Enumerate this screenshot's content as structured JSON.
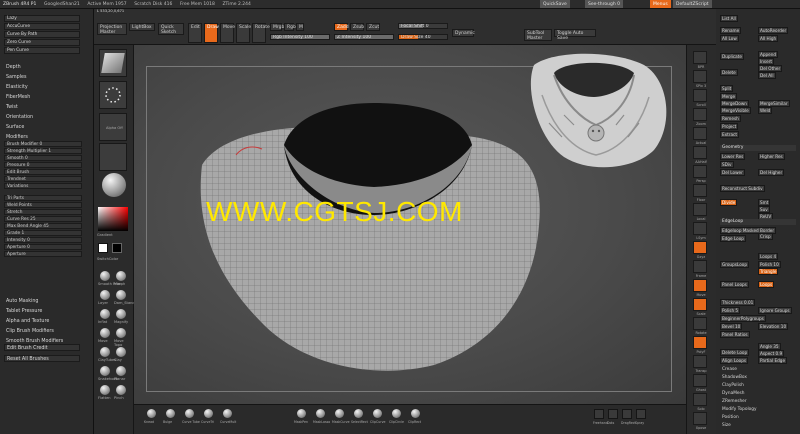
{
  "menubar": {
    "items": [
      "ZBrush 4R4 P1",
      "GoogledShan21",
      "Active Mem 1957",
      "Scratch Disk 416",
      "Free Mem 1018",
      "ZTime 2.244"
    ],
    "right": [
      "QuickSave",
      "See-through 0",
      "Menus",
      "DefaultZScript"
    ],
    "menus": [
      "Alpha",
      "Brush",
      "Color",
      "Document",
      "Draw",
      "Edit",
      "File",
      "Layer",
      "Light",
      "Macro",
      "Marker",
      "Material",
      "Movie",
      "Picker",
      "Preferences",
      "Render",
      "Stencil",
      "Stroke",
      "Texture",
      "Tool",
      "Transform",
      "Zplugin",
      "Zscript"
    ]
  },
  "toolbar": {
    "projection_master": "Projection Master",
    "lightbox": "LightBox",
    "quick_sketch": "Quick Sketch",
    "edit": "Edit",
    "draw": "Draw",
    "move": "Move",
    "scale": "Scale",
    "rotate": "Rotate",
    "mrgb": "Mrgb",
    "rgb": "Rgb",
    "m": "M",
    "rgb_intensity": "Rgb Intensity 100",
    "zadd": "Zadd",
    "zsub": "Zsub",
    "zcut": "Zcut",
    "z_intensity": "Z Intensity 100",
    "focal_shift": "Focal Shift 0",
    "draw_size": "Draw Size 40",
    "dynamic": "Dynamic",
    "subtool_master": "SubTool Master",
    "toggle_autosave": "Toggle Auto Save"
  },
  "leftpanel": {
    "top": [
      "Lazy",
      "AccuCurve",
      "Curve By Path",
      "Zero Curve",
      "Pen Curve"
    ],
    "sections": [
      "Depth",
      "Samples",
      "Elasticity",
      "FiberMesh",
      "Twist",
      "Orientation",
      "Surface",
      "Modifiers"
    ],
    "modifiers": [
      "Brush Modifier 0",
      "Strength Multiplier 1",
      "Smooth 0",
      "Pressure 0",
      "Edit Brush",
      "Trendnet",
      "Variations",
      "Tri Parts",
      "Weld Points",
      "Stretch",
      "Curve Res 25",
      "Max Bend Angle 45",
      "Grade 1",
      "Intensity 0",
      "Aperture 0",
      "Aperture"
    ],
    "bottom": [
      "Auto Masking",
      "Tablet Pressure",
      "Alpha and Texture",
      "Clip Brush Modifiers",
      "Smooth Brush Modifiers",
      "Edit Brush Credit",
      "Reset All Brushes"
    ]
  },
  "brushcol": {
    "labels": [
      "Alpha Off",
      "Gradient",
      "SwitchColor",
      "Smooth Prim",
      "Morph",
      "Layer",
      "Dam_Standard",
      "Inflat",
      "Magnify",
      "Move",
      "Move Topo",
      "ClayTubes",
      "Clay",
      "Snakehook",
      "Planar",
      "Flatten",
      "Pinch"
    ],
    "counter": "L 533,20,0,671"
  },
  "watermark": "WWW.CGTSJ.COM",
  "bottombar": {
    "labels": [
      "Knead",
      "Bulge",
      "Curve Tube",
      "CurveTri",
      "CurveMult",
      "MaskPen",
      "MaskLasso",
      "MaskCurve",
      "SelectRect",
      "ClipCurve",
      "ClipCircle",
      "ClipRect"
    ],
    "right": [
      "Freehand",
      "Dots",
      "DragRect",
      "Spray"
    ]
  },
  "iconstrip": {
    "labels": [
      "BPR",
      "SPix 3",
      "Scroll",
      "Zoom",
      "Actual",
      "AAHalf",
      "Persp",
      "Floor",
      "Local",
      "LSym",
      "Gxyz",
      "Frame",
      "Move",
      "Scale",
      "Rotate",
      "PolyF",
      "Transp",
      "Ghost",
      "Solo",
      "Xpose"
    ]
  },
  "rightpanel": {
    "top": [
      "List All",
      "Rename",
      "AutoReorder",
      "All Low",
      "All High",
      "Duplicate",
      "Append",
      "Insert",
      "Delete",
      "Del Other",
      "Del All",
      "Split",
      "Merge",
      "MergeDown",
      "MergeSimilar",
      "MergeVisible",
      "Weld",
      "Uv",
      "Remesh",
      "Project",
      "Extract"
    ],
    "geometry_head": "Geometry",
    "geometry": [
      "Lower Res",
      "Higher Res",
      "SDiv",
      "Del Lower",
      "Del Higher",
      "Reconstruct Subdiv",
      "Divide",
      "Smt",
      "Suv",
      "ReUV"
    ],
    "edgeloop_head": "EdgeLoop",
    "edgeloop": [
      "Edgeloop Masked Border",
      "Edge Loop",
      "Crisp",
      "Loops 4",
      "GroupsLoop",
      "Polish 10",
      "Triangle",
      "Panel Loops",
      "Loops",
      "Thickness 0.01",
      "Polish 5",
      "Ignore Groups",
      "BeginnerPolygroups",
      "Bevel 10",
      "Elevation 10",
      "Panel Ratios"
    ],
    "delete_loop": [
      "Delete Loop",
      "Angle 35",
      "Aspect 0.9",
      "Align Loops",
      "Partial Edge"
    ],
    "bottom": [
      "Crease",
      "ShadowBox",
      "ClayPolish",
      "DynaMesh",
      "ZRemesher",
      "Modify Topology",
      "Position",
      "Size"
    ]
  }
}
